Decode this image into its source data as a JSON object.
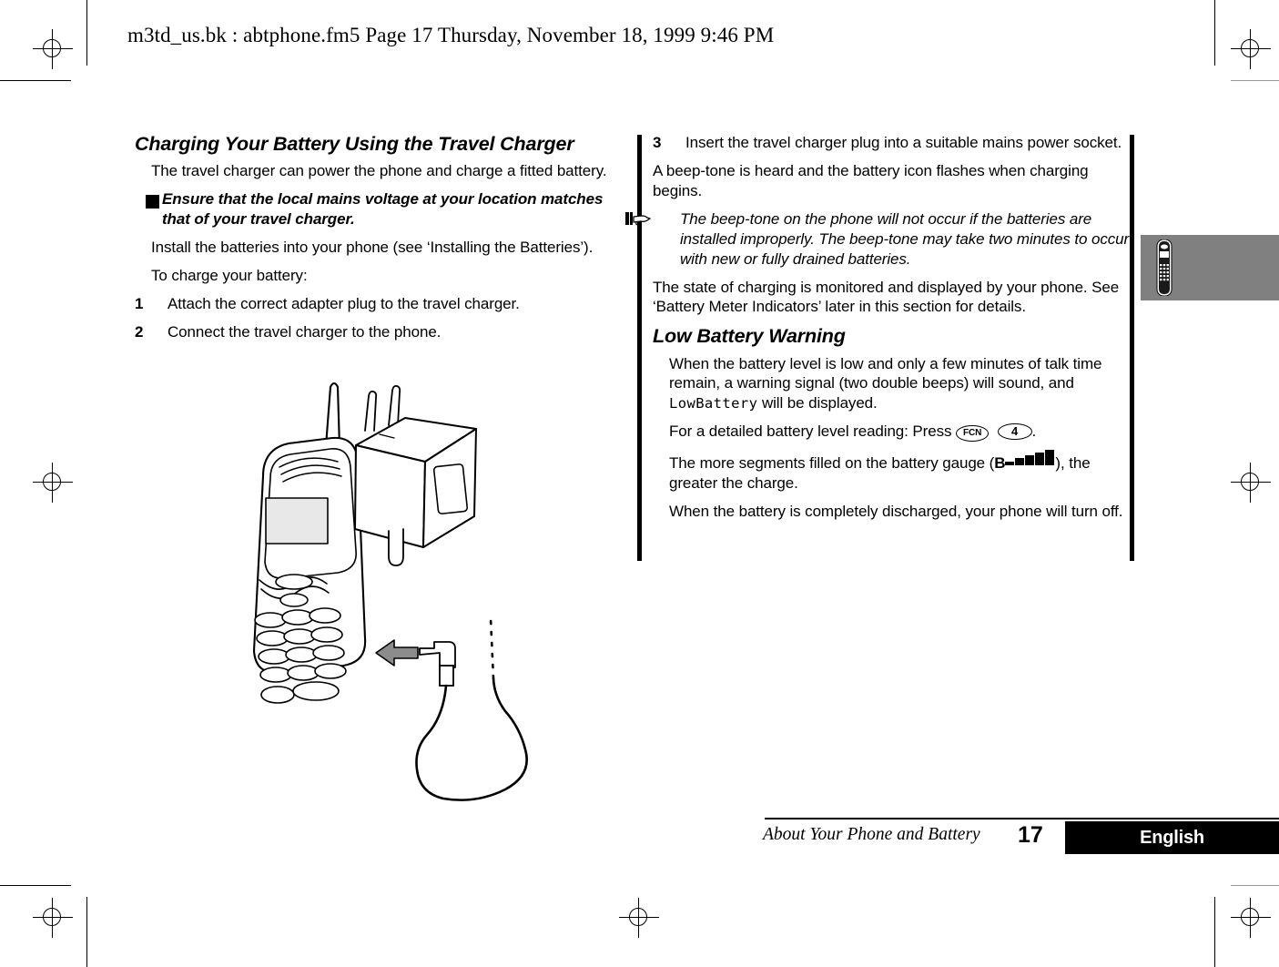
{
  "doc": {
    "header_line": "m3td_us.bk : abtphone.fm5  Page 17  Thursday, November 18, 1999  9:46 PM"
  },
  "left_column": {
    "heading": "Charging Your Battery Using the Travel Charger",
    "intro": "The travel charger can power the phone and charge a fitted battery.",
    "warning_icon": "!",
    "warning": "Ensure that the local mains voltage at your location matches that of your travel charger.",
    "install_note": "Install the batteries into your phone (see ‘Installing the Batteries’).",
    "to_charge": "To charge your battery:",
    "steps": [
      {
        "num": "1",
        "text": "Attach the correct adapter plug to the travel charger."
      },
      {
        "num": "2",
        "text": "Connect the travel charger to the phone."
      }
    ]
  },
  "figure": {
    "caption_alt": "Illustration of phone with travel charger adapter and cable"
  },
  "right_column": {
    "step3": {
      "num": "3",
      "text": "Insert the travel charger plug into a suitable mains power socket."
    },
    "beep_para": "A beep-tone is heard and the battery icon flashes when charging begins.",
    "hand_note": "The beep-tone on the phone will not occur if the batteries are installed improperly. The beep-tone may take two minutes to occur with new or fully drained batteries.",
    "state_para": "The state of charging is monitored and displayed by your phone. See ‘Battery Meter Indicators’ later in this section for details.",
    "low_battery_heading": "Low Battery Warning",
    "low_para_1a": "When the battery level is low and only a few minutes of talk time remain, a warning signal (two double beeps) will sound, and ",
    "low_lcd_1": "Low",
    "low_lcd_2": "Battery",
    "low_para_1b": " will be displayed.",
    "press_prefix": "For a detailed battery level reading: Press ",
    "key_fcn": "FCN",
    "key_four": "4",
    "press_suffix": ".",
    "gauge_prefix": "The more segments filled on the battery gauge (",
    "gauge_letter": "B",
    "gauge_suffix": "), the greater the charge.",
    "discharged_para": "When the battery is completely discharged, your phone will turn off."
  },
  "edge_tab": {
    "icon": "phone-icon",
    "color": "#808080"
  },
  "footer": {
    "section": "About Your Phone and Battery",
    "page_number": "17",
    "language": "English"
  }
}
